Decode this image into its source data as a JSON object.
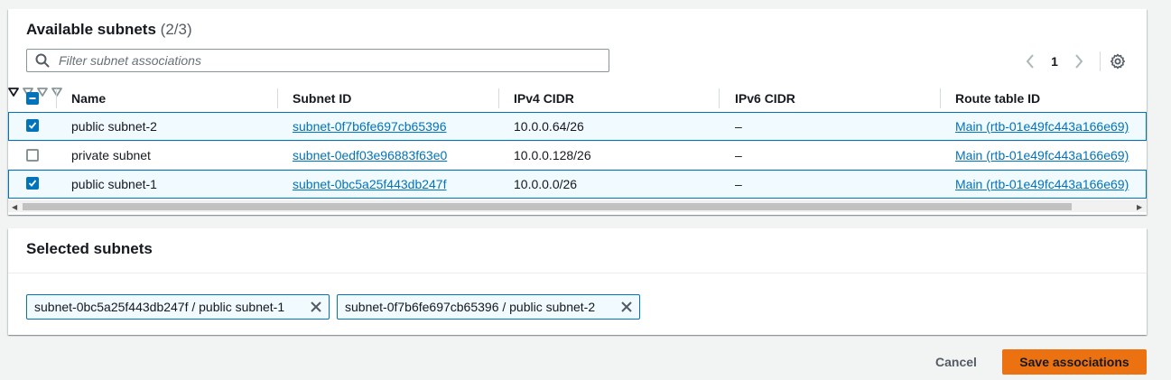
{
  "available": {
    "title": "Available subnets",
    "count": "(2/3)",
    "filter_placeholder": "Filter subnet associations",
    "pager": {
      "page": "1"
    },
    "columns": {
      "name": "Name",
      "subnet_id": "Subnet ID",
      "ipv4": "IPv4 CIDR",
      "ipv6": "IPv6 CIDR",
      "route_table": "Route table ID"
    },
    "rows": [
      {
        "selected": true,
        "name": "public subnet-2",
        "subnet_id": "subnet-0f7b6fe697cb65396",
        "ipv4": "10.0.0.64/26",
        "ipv6": "–",
        "route_table": "Main (rtb-01e49fc443a166e69)"
      },
      {
        "selected": false,
        "name": "private subnet",
        "subnet_id": "subnet-0edf03e96883f63e0",
        "ipv4": "10.0.0.128/26",
        "ipv6": "–",
        "route_table": "Main (rtb-01e49fc443a166e69)"
      },
      {
        "selected": true,
        "name": "public subnet-1",
        "subnet_id": "subnet-0bc5a25f443db247f",
        "ipv4": "10.0.0.0/26",
        "ipv6": "–",
        "route_table": "Main (rtb-01e49fc443a166e69)"
      }
    ]
  },
  "selected_panel": {
    "title": "Selected subnets",
    "tokens": [
      {
        "label": "subnet-0bc5a25f443db247f / public subnet-1"
      },
      {
        "label": "subnet-0f7b6fe697cb65396 / public subnet-2"
      }
    ]
  },
  "footer": {
    "cancel_label": "Cancel",
    "save_label": "Save associations"
  },
  "colors": {
    "accent": "#0073bb",
    "primary_button": "#ec7211",
    "selected_row_bg": "#f1faff"
  }
}
